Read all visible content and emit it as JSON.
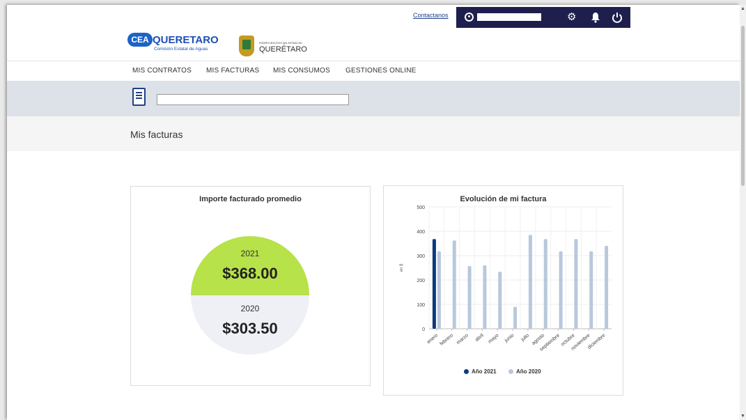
{
  "header": {
    "contact_link": "Contactanos",
    "icons": [
      "user-icon",
      "gear-icon",
      "bell-icon",
      "power-icon"
    ]
  },
  "brand": {
    "logo_badge": "CEA",
    "name": "QUERETARO",
    "subtitle": "Comisión Estatal de Aguas",
    "gov_small": "PODER EJECUTIVO DEL ESTADO DE",
    "gov_name": "QUERÉTARO"
  },
  "nav": {
    "items": [
      "MIS CONTRATOS",
      "MIS FACTURAS",
      "MIS CONSUMOS",
      "GESTIONES ONLINE"
    ]
  },
  "page": {
    "title": "Mis facturas"
  },
  "average_card": {
    "title": "Importe facturado promedio",
    "top": {
      "year": "2021",
      "amount": "$368.00",
      "color": "#b7e24a"
    },
    "bottom": {
      "year": "2020",
      "amount": "$303.50",
      "color": "#eef0f6"
    }
  },
  "evolution_card": {
    "title": "Evolución de mi factura"
  },
  "colors": {
    "series_2021": "#0d3b7a",
    "series_2020": "#b8c8dc",
    "header_bar": "#1f1f4e",
    "nav_link": "#1f3f8a"
  },
  "chart_data": {
    "type": "bar",
    "title": "Evolución de mi factura",
    "ylabel": "en $",
    "xlabel": "",
    "ylim": [
      0,
      500
    ],
    "yticks": [
      0,
      100,
      200,
      300,
      400,
      500
    ],
    "grid": true,
    "legend": "bottom",
    "categories": [
      "enero",
      "febrero",
      "marzo",
      "abril",
      "mayo",
      "junio",
      "julio",
      "agosto",
      "septiembre",
      "octubre",
      "noviembre",
      "diciembre"
    ],
    "series": [
      {
        "name": "Año 2021",
        "values": [
          368,
          null,
          null,
          null,
          null,
          null,
          null,
          null,
          null,
          null,
          null,
          null
        ]
      },
      {
        "name": "Año 2020",
        "values": [
          318,
          362,
          257,
          260,
          234,
          90,
          385,
          368,
          318,
          368,
          318,
          340
        ]
      }
    ]
  }
}
